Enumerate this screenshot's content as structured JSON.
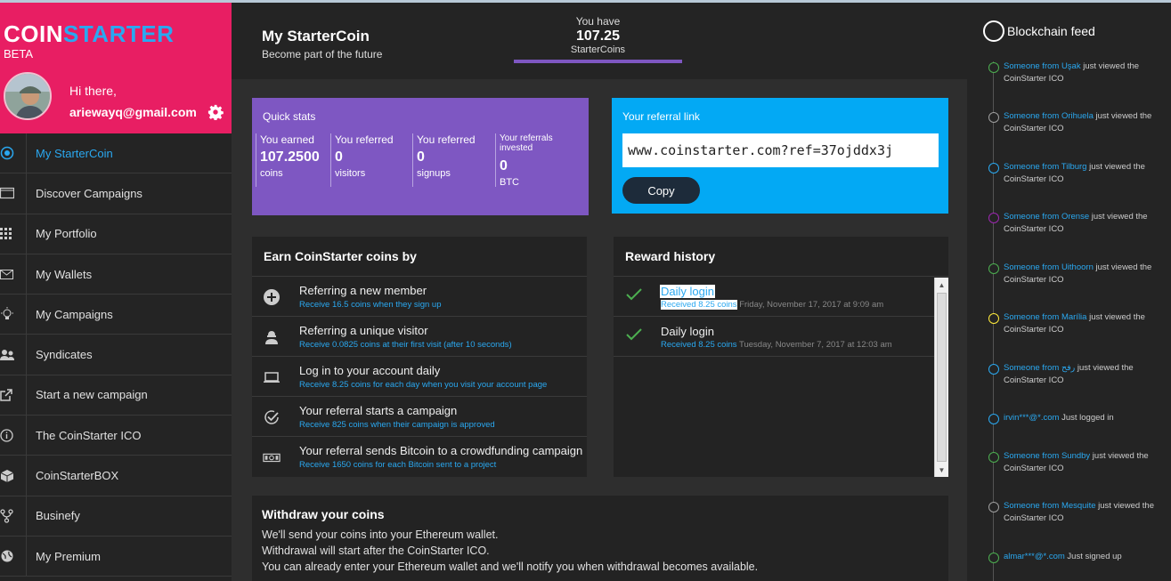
{
  "brand": {
    "logo_a": "COIN",
    "logo_b": "STARTER",
    "beta": "BETA"
  },
  "user": {
    "greeting": "Hi there,",
    "email": "ariewayq@gmail.com"
  },
  "nav": [
    {
      "label": "My StarterCoin",
      "icon": "target-icon",
      "active": true
    },
    {
      "label": "Discover Campaigns",
      "icon": "window-icon"
    },
    {
      "label": "My Portfolio",
      "icon": "grid-icon"
    },
    {
      "label": "My Wallets",
      "icon": "envelope-icon"
    },
    {
      "label": "My Campaigns",
      "icon": "bulb-icon"
    },
    {
      "label": "Syndicates",
      "icon": "group-icon"
    },
    {
      "label": "Start a new campaign",
      "icon": "external-link-icon"
    },
    {
      "label": " The CoinStarter ICO",
      "icon": "info-icon"
    },
    {
      "label": "CoinStarterBOX",
      "icon": "box-icon"
    },
    {
      "label": "Businefy",
      "icon": "fork-icon"
    },
    {
      "label": "My Premium",
      "icon": "globe-icon"
    }
  ],
  "header": {
    "title": "My StarterCoin",
    "subtitle": "Become part of the future"
  },
  "balance": {
    "label": "You have",
    "value": "107.25",
    "unit": "StarterCoins"
  },
  "quick_stats": {
    "title": "Quick stats",
    "items": [
      {
        "label": "You earned",
        "value": "107.2500",
        "unit": "coins"
      },
      {
        "label": "You referred",
        "value": "0",
        "unit": "visitors"
      },
      {
        "label": "You referred",
        "value": "0",
        "unit": "signups"
      },
      {
        "label": "Your referrals invested",
        "value": "0",
        "unit": "BTC"
      }
    ]
  },
  "referral": {
    "title": "Your referral link",
    "link": "www.coinstarter.com?ref=37ojddx3j",
    "copy_label": "Copy"
  },
  "earn": {
    "title": "Earn CoinStarter coins by",
    "items": [
      {
        "title": "Referring a new member",
        "sub": "Receive 16.5 coins when they sign up",
        "icon": "plus-circle-icon"
      },
      {
        "title": "Referring a unique visitor",
        "sub": "Receive 0.0825 coins at their first visit (after 10 seconds)",
        "icon": "user-icon"
      },
      {
        "title": "Log in to your account daily",
        "sub": "Receive 8.25 coins for each day when you visit your account page",
        "icon": "laptop-icon"
      },
      {
        "title": "Your referral starts a campaign",
        "sub": "Receive 825 coins when their campaign is approved",
        "icon": "check-circle-icon"
      },
      {
        "title": "Your referral sends Bitcoin to a crowdfunding campaign",
        "sub": "Receive 1650 coins for each Bitcoin sent to a project",
        "icon": "money-icon"
      }
    ]
  },
  "reward_history": {
    "title": "Reward history",
    "items": [
      {
        "title": "Daily login",
        "received": "Received 8.25 coins",
        "date": " Friday, November 17, 2017 at 9:09 am",
        "selected": true
      },
      {
        "title": "Daily login",
        "received": "Received 8.25 coins",
        "date": " Tuesday, November 7, 2017 at 12:03 am",
        "selected": false
      }
    ]
  },
  "withdraw": {
    "title": "Withdraw your coins",
    "lines": [
      "We'll send your coins into your Ethereum wallet.",
      "Withdrawal will start after the CoinStarter ICO.",
      "You can already enter your Ethereum wallet and we'll notify you when withdrawal becomes available."
    ]
  },
  "feed": {
    "title": "Blockchain feed",
    "items": [
      {
        "who": "Someone from Uşak",
        "action": " just viewed the CoinStarter ICO",
        "color": "#4caf50"
      },
      {
        "who": "Someone from Orihuela",
        "action": " just viewed the CoinStarter ICO",
        "color": "#9e9e9e"
      },
      {
        "who": "Someone from Tilburg",
        "action": " just viewed the CoinStarter ICO",
        "color": "#2aa8f0"
      },
      {
        "who": "Someone from Orense",
        "action": " just viewed the CoinStarter ICO",
        "color": "#9c27b0"
      },
      {
        "who": "Someone from Uithoorn",
        "action": " just viewed the CoinStarter ICO",
        "color": "#4caf50"
      },
      {
        "who": "Someone from Marília",
        "action": " just viewed the CoinStarter ICO",
        "color": "#ffeb3b"
      },
      {
        "who": "Someone from رفح",
        "action": " just viewed the CoinStarter ICO",
        "color": "#2aa8f0"
      },
      {
        "who": "irvin***@*.com",
        "action": " Just logged in",
        "color": "#2aa8f0"
      },
      {
        "who": "Someone from Sundby",
        "action": " just viewed the CoinStarter ICO",
        "color": "#4caf50"
      },
      {
        "who": "Someone from Mesquite",
        "action": " just viewed the CoinStarter ICO",
        "color": "#9e9e9e"
      },
      {
        "who": "almar***@*.com",
        "action": " Just signed up",
        "color": "#4caf50"
      }
    ]
  }
}
